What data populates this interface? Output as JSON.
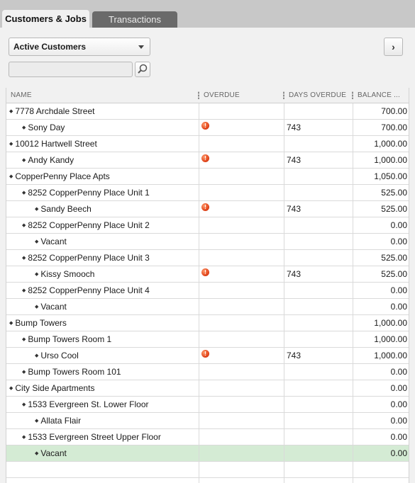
{
  "tabs": [
    {
      "label": "Customers & Jobs",
      "active": true
    },
    {
      "label": "Transactions",
      "active": false
    }
  ],
  "view_select": {
    "selected": "Active Customers"
  },
  "search": {
    "placeholder": "",
    "value": ""
  },
  "nav_button": {
    "glyph": "›"
  },
  "columns": {
    "name": "NAME",
    "overdue": "OVERDUE",
    "days_overdue": "DAYS OVERDUE",
    "balance": "BALANCE ..."
  },
  "rows": [
    {
      "name": "7778 Archdale Street",
      "level": 0,
      "overdue": false,
      "days": "",
      "balance": "700.00"
    },
    {
      "name": "Sony Day",
      "level": 1,
      "overdue": true,
      "days": "743",
      "balance": "700.00"
    },
    {
      "name": "10012 Hartwell Street",
      "level": 0,
      "overdue": false,
      "days": "",
      "balance": "1,000.00"
    },
    {
      "name": "Andy Kandy",
      "level": 1,
      "overdue": true,
      "days": "743",
      "balance": "1,000.00"
    },
    {
      "name": "CopperPenny Place Apts",
      "level": 0,
      "overdue": false,
      "days": "",
      "balance": "1,050.00"
    },
    {
      "name": "8252 CopperPenny Place Unit 1",
      "level": 1,
      "overdue": false,
      "days": "",
      "balance": "525.00"
    },
    {
      "name": "Sandy Beech",
      "level": 2,
      "overdue": true,
      "days": "743",
      "balance": "525.00"
    },
    {
      "name": "8252 CopperPenny Place Unit 2",
      "level": 1,
      "overdue": false,
      "days": "",
      "balance": "0.00"
    },
    {
      "name": "Vacant",
      "level": 2,
      "overdue": false,
      "days": "",
      "balance": "0.00"
    },
    {
      "name": "8252 CopperPenny Place Unit 3",
      "level": 1,
      "overdue": false,
      "days": "",
      "balance": "525.00"
    },
    {
      "name": "Kissy Smooch",
      "level": 2,
      "overdue": true,
      "days": "743",
      "balance": "525.00"
    },
    {
      "name": "8252 CopperPenny Place Unit 4",
      "level": 1,
      "overdue": false,
      "days": "",
      "balance": "0.00"
    },
    {
      "name": "Vacant",
      "level": 2,
      "overdue": false,
      "days": "",
      "balance": "0.00"
    },
    {
      "name": "Bump Towers",
      "level": 0,
      "overdue": false,
      "days": "",
      "balance": "1,000.00"
    },
    {
      "name": "Bump Towers Room 1",
      "level": 1,
      "overdue": false,
      "days": "",
      "balance": "1,000.00"
    },
    {
      "name": "Urso Cool",
      "level": 2,
      "overdue": true,
      "days": "743",
      "balance": "1,000.00"
    },
    {
      "name": "Bump Towers Room 101",
      "level": 1,
      "overdue": false,
      "days": "",
      "balance": "0.00"
    },
    {
      "name": "City Side Apartments",
      "level": 0,
      "overdue": false,
      "days": "",
      "balance": "0.00"
    },
    {
      "name": "1533 Evergreen St. Lower Floor",
      "level": 1,
      "overdue": false,
      "days": "",
      "balance": "0.00"
    },
    {
      "name": "Allata Flair",
      "level": 2,
      "overdue": false,
      "days": "",
      "balance": "0.00"
    },
    {
      "name": "1533 Evergreen Street Upper Floor",
      "level": 1,
      "overdue": false,
      "days": "",
      "balance": "0.00"
    },
    {
      "name": "Vacant",
      "level": 2,
      "overdue": false,
      "days": "",
      "balance": "0.00",
      "selected": true
    }
  ],
  "colors": {
    "selected_row": "#d4ebd4",
    "overdue_icon": "#e2461d",
    "inactive_tab": "#6a6a6a"
  },
  "icons": {
    "overdue": "alert-icon",
    "search": "search-icon",
    "nav": "chevron-right-icon",
    "dropdown": "chevron-down-icon"
  }
}
